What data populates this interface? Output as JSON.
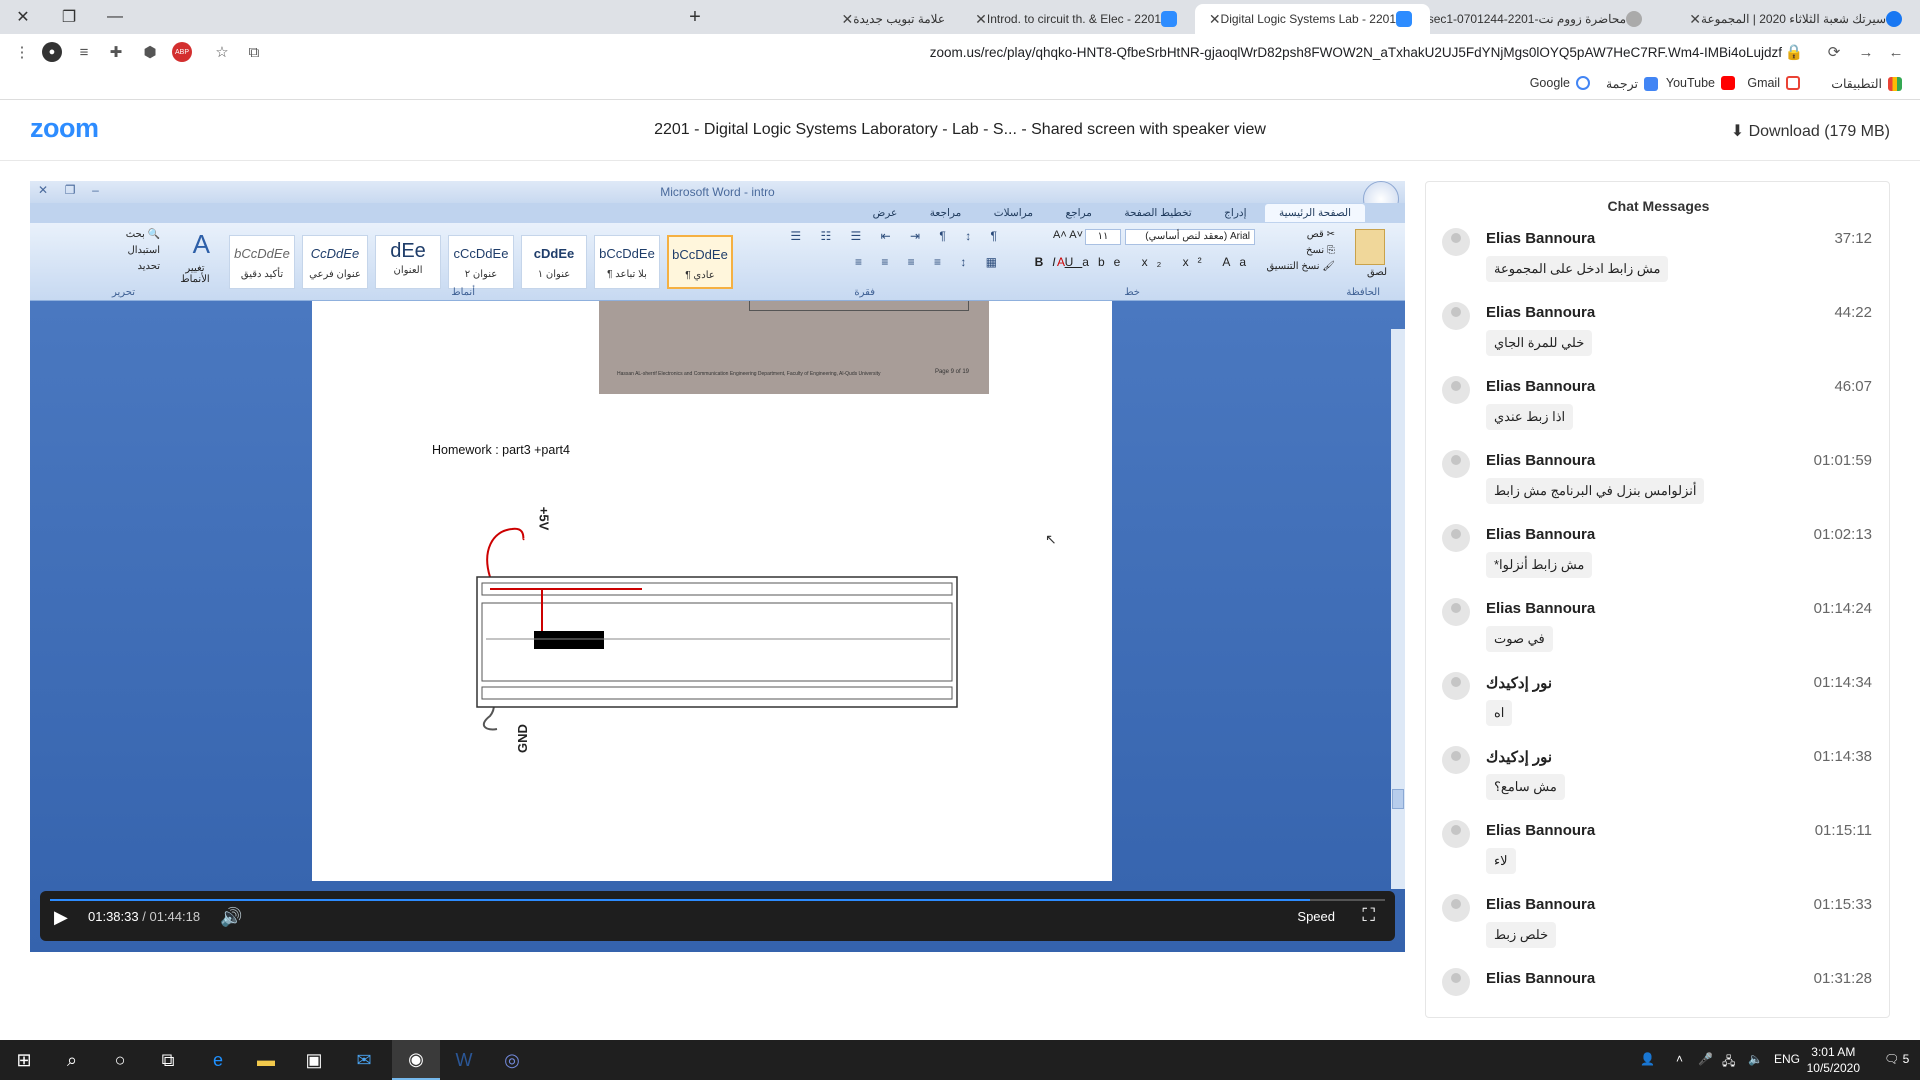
{
  "browser": {
    "tabs": [
      {
        "label": "سيرتك شعبة الثلاثاء 2020 | المجموعة",
        "icon": "facebook-icon",
        "active": false
      },
      {
        "label": "محاضرة زووم نت-2201-0701244-sec1",
        "icon": "app-icon",
        "active": false
      },
      {
        "label": "2201 - Digital Logic Systems Lab",
        "icon": "zoom-icon",
        "active": true
      },
      {
        "label": "2201 - Introd. to circuit th. & Elec",
        "icon": "zoom-icon",
        "active": false
      },
      {
        "label": "علامة تبويب جديدة",
        "icon": "none",
        "active": false
      }
    ],
    "url": "zoom.us/rec/play/qhqko-HNT8-QfbeSrbHtNR-gjaoqlWrD82psh8FWOW2N_aTxhakU2UJ5FdYNjMgs0lOYQ5pAW7HeC7RF.Wm4-IMBi4oLujdzf",
    "bookmarks": [
      "التطبيقات",
      "Gmail",
      "YouTube",
      "ترجمة",
      "Google"
    ]
  },
  "zoom": {
    "logo": "zoom",
    "title": "2201 - Digital Logic Systems Laboratory - Lab - S...  - Shared screen with speaker view",
    "download": "Download (179 MB)"
  },
  "word": {
    "title": "Microsoft Word - intro",
    "tabs": [
      "الصفحة الرئيسية",
      "إدراج",
      "تخطيط الصفحة",
      "مراجع",
      "مراسلات",
      "مراجعة",
      "عرض"
    ],
    "groups": [
      "الحافظة",
      "خط",
      "فقرة",
      "أنماط",
      "تحرير"
    ],
    "clipboard": {
      "paste": "لصق",
      "cut": "قص",
      "copy": "نسخ",
      "format": "نسخ التنسيق"
    },
    "font": {
      "name": "Arial (معقد لنص أساسي)",
      "size": "١١"
    },
    "styles": [
      {
        "sample": "bCcDdEe",
        "name": "¶ عادي",
        "selected": true
      },
      {
        "sample": "bCcDdEe",
        "name": "¶ بلا تباعد",
        "selected": false
      },
      {
        "sample": "cDdEe",
        "name": "عنوان ١",
        "selected": false
      },
      {
        "sample": "cCcDdEe",
        "name": "عنوان ٢",
        "selected": false
      },
      {
        "sample": "dEe",
        "name": "العنوان",
        "selected": false
      },
      {
        "sample": "CcDdEe",
        "name": "عنوان فرعي",
        "selected": false
      },
      {
        "sample": "bCcDdEe",
        "name": "تأكيد دقيق",
        "selected": false
      }
    ],
    "change_styles": "تغيير الأنماط",
    "editing": {
      "find": "بحث",
      "replace": "استبدال",
      "select": "تحديد"
    },
    "document": {
      "homework": "Homework : part3 +part4",
      "plus5v": "+5V",
      "gnd": "GND",
      "scan_caption": "Hassan AL-sherrif Electronics and Communication Engineering Department, Faculty of Engineering, Al-Quds University",
      "scan_page": "Page 9 of 19"
    }
  },
  "player": {
    "current": "01:38:33",
    "duration": "/ 01:44:18",
    "speed": "Speed",
    "progress": 0.944
  },
  "chat": {
    "title": "Chat Messages",
    "messages": [
      {
        "sender": "Elias Bannoura",
        "time": "37:12",
        "text": "مش زابط ادخل على المجموعة"
      },
      {
        "sender": "Elias Bannoura",
        "time": "44:22",
        "text": "خلي للمرة الجاي"
      },
      {
        "sender": "Elias Bannoura",
        "time": "46:07",
        "text": "اذا زبط عندي"
      },
      {
        "sender": "Elias Bannoura",
        "time": "01:01:59",
        "text": "أنزلوامس بنزل في البرنامج مش زابط"
      },
      {
        "sender": "Elias Bannoura",
        "time": "01:02:13",
        "text": "مش زابط أنزلوا*"
      },
      {
        "sender": "Elias Bannoura",
        "time": "01:14:24",
        "text": "في صوت"
      },
      {
        "sender": "نور إدكيدك",
        "time": "01:14:34",
        "text": "اه"
      },
      {
        "sender": "نور إدكيدك",
        "time": "01:14:38",
        "text": "مش سامع؟"
      },
      {
        "sender": "Elias Bannoura",
        "time": "01:15:11",
        "text": "لاء"
      },
      {
        "sender": "Elias Bannoura",
        "time": "01:15:33",
        "text": "خلص زبط"
      },
      {
        "sender": "Elias Bannoura",
        "time": "01:31:28",
        "text": ""
      }
    ]
  },
  "taskbar": {
    "lang": "ENG",
    "time": "3:01 AM",
    "date": "10/5/2020",
    "notifications": "5"
  }
}
